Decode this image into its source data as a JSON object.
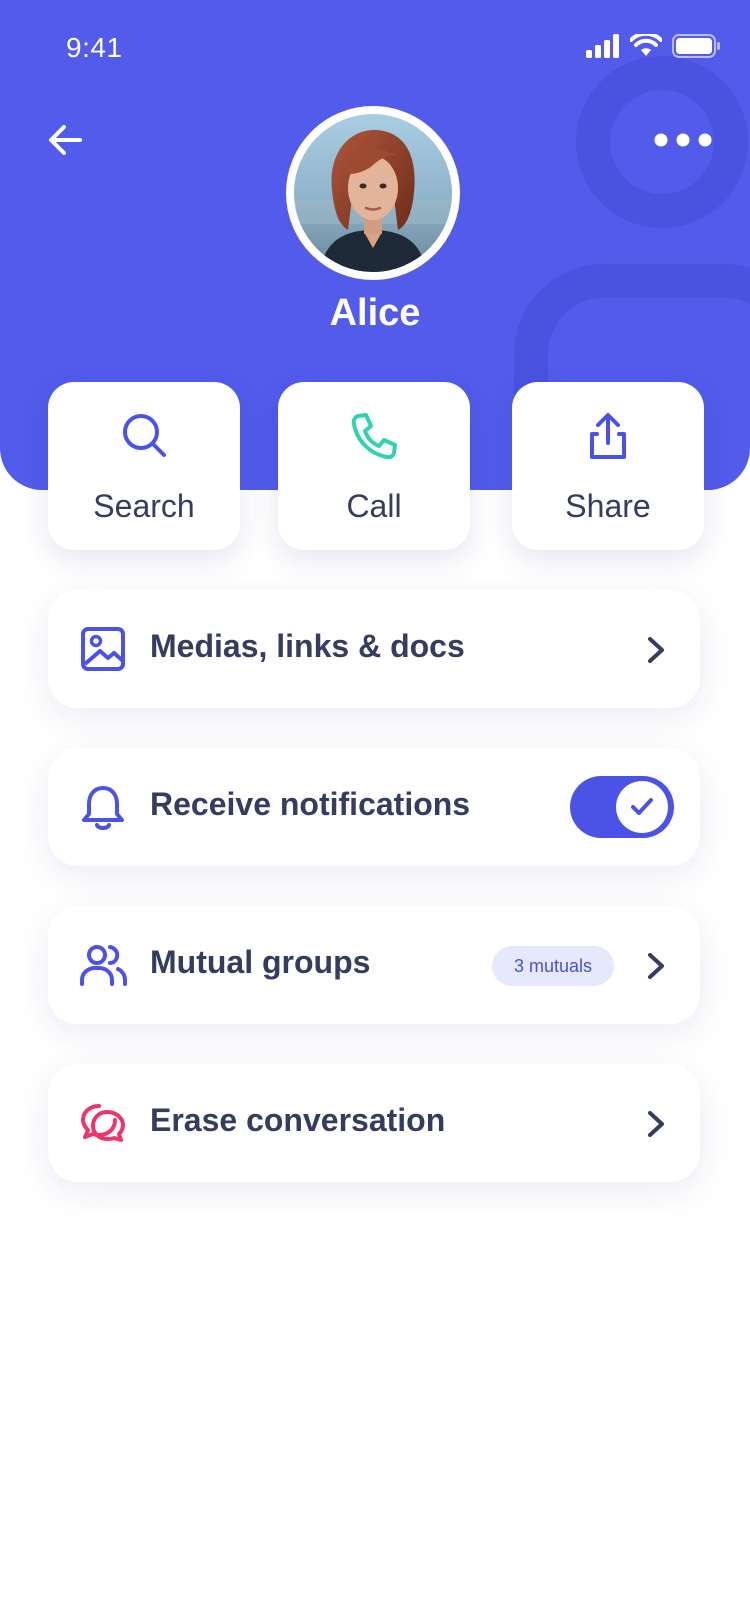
{
  "status_bar": {
    "time": "9:41"
  },
  "header": {
    "contact_name": "Alice",
    "accent_color": "#525bea"
  },
  "actions": [
    {
      "label": "Search",
      "icon": "search-icon"
    },
    {
      "label": "Call",
      "icon": "phone-icon"
    },
    {
      "label": "Share",
      "icon": "share-icon"
    }
  ],
  "settings": {
    "medias": {
      "label": "Medias, links & docs",
      "icon": "image-icon"
    },
    "notifications": {
      "label": "Receive notifications",
      "icon": "bell-icon",
      "enabled": true
    },
    "mutual_groups": {
      "label": "Mutual groups",
      "badge": "3 mutuals",
      "icon": "users-icon"
    },
    "erase": {
      "label": "Erase conversation",
      "icon": "chat-bubbles-icon",
      "icon_color": "#f0336a"
    }
  }
}
